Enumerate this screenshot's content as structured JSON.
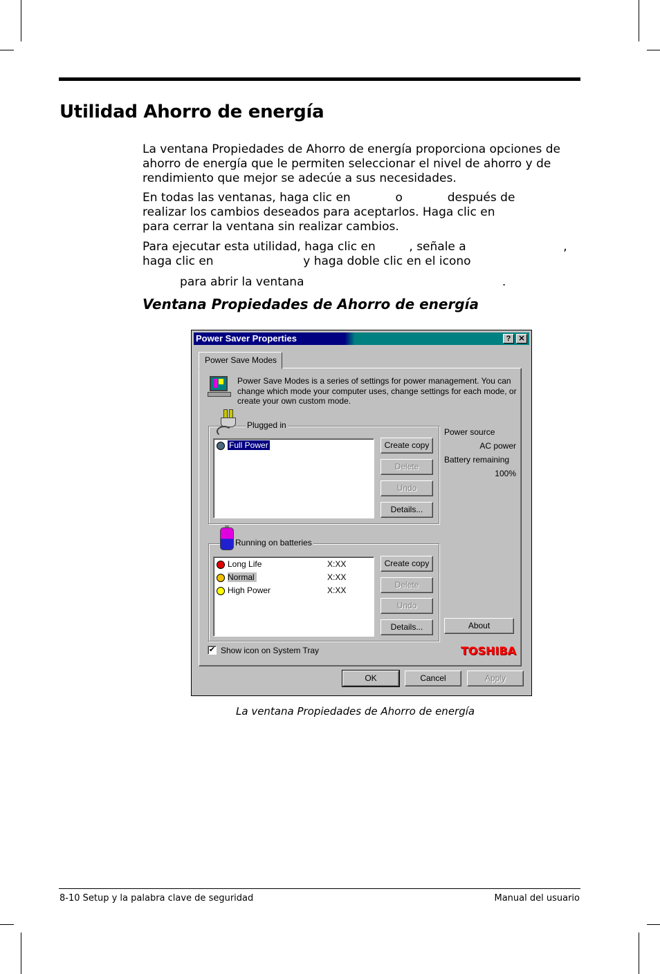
{
  "document": {
    "heading": "Utilidad Ahorro de energía",
    "paragraphs": [
      [
        "La ventana Propiedades de Ahorro de energía proporciona opciones de",
        "ahorro de energía que le permiten seleccionar el nivel de ahorro y de",
        "rendimiento que mejor se adecúe a sus necesidades."
      ],
      [
        "En todas las ventanas, haga clic en            o            después de",
        "realizar los cambios deseados para aceptarlos. Haga clic en",
        "para cerrar la ventana sin realizar cambios."
      ],
      [
        "Para ejecutar esta utilidad, haga clic en         , señale a                          ,",
        "haga clic en                        y haga doble clic en el icono",
        "          para abrir la ventana                                                     ."
      ]
    ],
    "subheading": "Ventana Propiedades de Ahorro de energía",
    "caption": "La ventana Propiedades de Ahorro de energía",
    "footer_left": "8-10  Setup y la palabra clave de seguridad",
    "footer_right": "Manual del usuario"
  },
  "window": {
    "title": "Power Saver Properties",
    "help": "?",
    "close": "✕",
    "tab": "Power Save Modes",
    "description": [
      "Power Save Modes is a series of settings for power management. You can",
      "change which mode your computer uses, change settings for each mode, or",
      "create your own custom mode."
    ],
    "plugged": {
      "label": "Plugged in",
      "items": [
        {
          "name": "Full Power",
          "color": "#4a6a80",
          "selected": true
        }
      ]
    },
    "batteries": {
      "label": "Running on batteries",
      "items": [
        {
          "name": "Long Life",
          "time": "X:XX",
          "color": "#e00000"
        },
        {
          "name": "Normal",
          "time": "X:XX",
          "color": "#f0c000"
        },
        {
          "name": "High Power",
          "time": "X:XX",
          "color": "#ffff00"
        }
      ]
    },
    "buttons": {
      "create_copy": "Create copy",
      "delete": "Delete",
      "undo": "Undo",
      "details": "Details...",
      "about": "About",
      "ok": "OK",
      "cancel": "Cancel",
      "apply": "Apply"
    },
    "status": {
      "power_source_label": "Power source",
      "power_source": "AC power",
      "battery_label": "Battery remaining",
      "battery": "100%"
    },
    "show_icon": {
      "label": "Show icon on System Tray",
      "checked": true
    },
    "brand": "TOSHIBA",
    "colors": {
      "titlebar": "#000080",
      "titlebar_end": "#008080",
      "face": "#c0c0c0",
      "brand": "#ff0000"
    }
  }
}
